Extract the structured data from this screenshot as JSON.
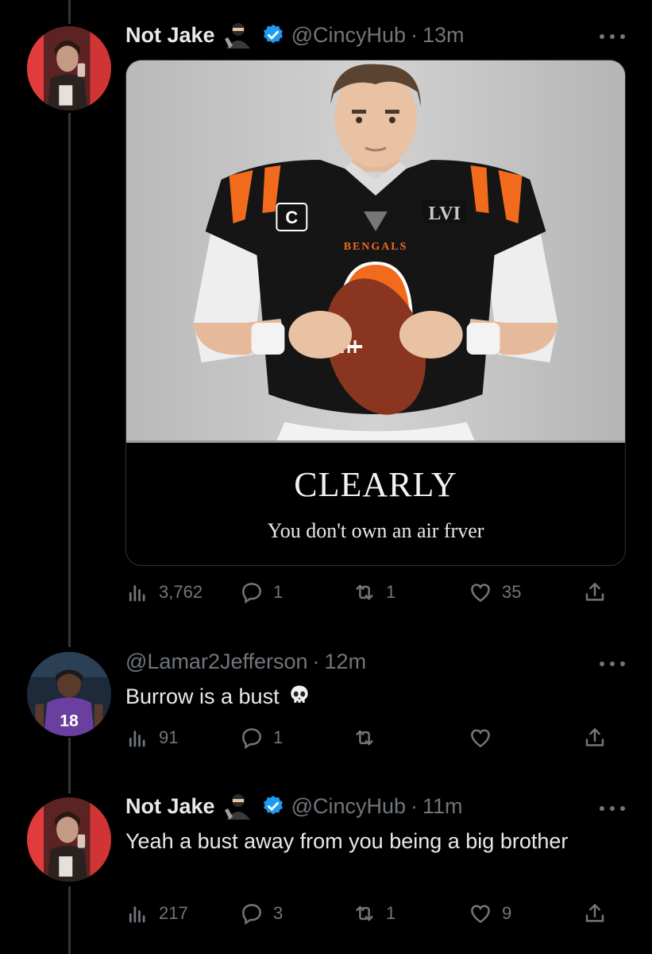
{
  "tweets": [
    {
      "name": "Not Jake",
      "handle": "@CincyHub",
      "time": "13m",
      "verified": true,
      "media": {
        "caption_main": "CLEARLY",
        "caption_sub": "You don't own an air frver"
      },
      "stats": {
        "views": "3,762",
        "replies": "1",
        "retweets": "1",
        "likes": "35"
      }
    },
    {
      "name": "",
      "handle": "@Lamar2Jefferson",
      "time": "12m",
      "text": "Burrow is a bust",
      "stats": {
        "views": "91",
        "replies": "1",
        "retweets": "",
        "likes": ""
      }
    },
    {
      "name": "Not Jake",
      "handle": "@CincyHub",
      "time": "11m",
      "verified": true,
      "text": "Yeah a bust away from you being a big brother",
      "stats": {
        "views": "217",
        "replies": "3",
        "retweets": "1",
        "likes": "9"
      }
    }
  ],
  "separator": "·",
  "colors": {
    "background": "#000000",
    "text": "#e7e9ea",
    "muted": "#71767b",
    "verified": "#1d9bf0",
    "thread_line": "#333639"
  },
  "icons": [
    "views-icon",
    "reply-icon",
    "retweet-icon",
    "like-icon",
    "share-icon",
    "more-icon",
    "verified-icon",
    "ninja-emoji-icon",
    "skull-emoji-icon"
  ]
}
